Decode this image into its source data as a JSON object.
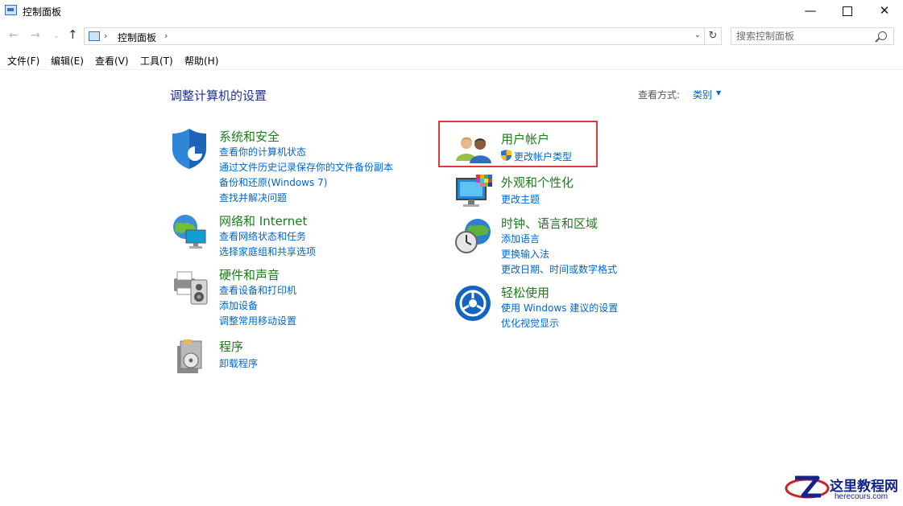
{
  "window": {
    "title": "控制面板",
    "minimize": "—",
    "close": "✕"
  },
  "address": {
    "crumb_sep": "›",
    "crumb": "控制面板",
    "dropdown": "⌄",
    "refresh": "↻",
    "search_placeholder": "搜索控制面板"
  },
  "nav": {
    "back": "←",
    "forward": "→",
    "recent": "⌄",
    "up": "↑"
  },
  "menu": [
    "文件(F)",
    "编辑(E)",
    "查看(V)",
    "工具(T)",
    "帮助(H)"
  ],
  "content": {
    "title": "调整计算机的设置",
    "view_label": "查看方式:",
    "view_value": "类别",
    "view_caret": "▼"
  },
  "categories": {
    "system": {
      "title": "系统和安全",
      "links": [
        "查看你的计算机状态",
        "通过文件历史记录保存你的文件备份副本",
        "备份和还原(Windows 7)",
        "查找并解决问题"
      ]
    },
    "network": {
      "title": "网络和 Internet",
      "links": [
        "查看网络状态和任务",
        "选择家庭组和共享选项"
      ]
    },
    "hardware": {
      "title": "硬件和声音",
      "links": [
        "查看设备和打印机",
        "添加设备",
        "调整常用移动设置"
      ]
    },
    "programs": {
      "title": "程序",
      "links": [
        "卸载程序"
      ]
    },
    "user": {
      "title": "用户帐户",
      "links": [
        "更改帐户类型"
      ]
    },
    "appearance": {
      "title": "外观和个性化",
      "links": [
        "更改主题"
      ]
    },
    "clock": {
      "title": "时钟、语言和区域",
      "links": [
        "添加语言",
        "更换输入法",
        "更改日期、时间或数字格式"
      ]
    },
    "ease": {
      "title": "轻松使用",
      "links": [
        "使用 Windows 建议的设置",
        "优化视觉显示"
      ]
    }
  },
  "watermark": {
    "title": "这里教程网",
    "site": "herecours.com"
  },
  "colors": {
    "category_title": "#1e7b1e",
    "link": "#0066cc",
    "heading": "#1e3287",
    "highlight": "#e03b3b"
  }
}
